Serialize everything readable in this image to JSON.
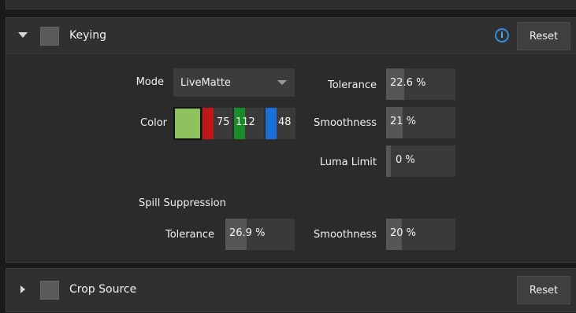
{
  "keying": {
    "title": "Keying",
    "info_icon": "i",
    "reset_label": "Reset",
    "mode": {
      "label": "Mode",
      "value": "LiveMatte"
    },
    "color": {
      "label": "Color",
      "swatch": "#8fc15e",
      "red": {
        "value": "75",
        "color": "#c01818"
      },
      "green": {
        "value": "112",
        "color": "#1a8a2a"
      },
      "blue": {
        "value": "48",
        "color": "#1a6fd8"
      }
    },
    "tolerance": {
      "label": "Tolerance",
      "value": "22.6 %",
      "level": 0.226
    },
    "smoothness": {
      "label": "Smoothness",
      "value": "21 %",
      "level": 0.21
    },
    "luma_limit": {
      "label": "Luma Limit",
      "value": "0 %",
      "level": 0.0
    },
    "spill": {
      "heading": "Spill Suppression",
      "tolerance": {
        "label": "Tolerance",
        "value": "26.9 %",
        "level": 0.269
      },
      "smoothness": {
        "label": "Smoothness",
        "value": "20 %",
        "level": 0.2
      }
    }
  },
  "crop": {
    "title": "Crop Source",
    "reset_label": "Reset"
  }
}
